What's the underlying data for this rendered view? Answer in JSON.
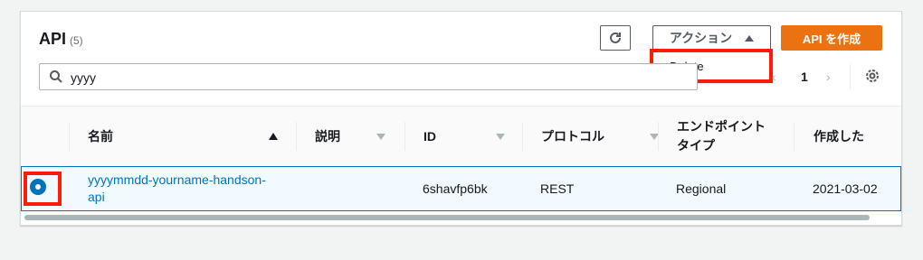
{
  "header": {
    "title": "API",
    "count": "(5)"
  },
  "toolbar": {
    "refresh_icon": "refresh-icon",
    "actions_label": "アクション",
    "create_label": "API を作成"
  },
  "actions_menu": {
    "items": [
      "Delete"
    ]
  },
  "search": {
    "value": "yyyy",
    "icon": "search-icon"
  },
  "pagination": {
    "current_page": "1",
    "prev": "‹",
    "next": "›"
  },
  "settings_icon": "gear-icon",
  "table": {
    "columns": [
      "名前",
      "説明",
      "ID",
      "プロトコル",
      "エンドポイントタイプ",
      "作成した"
    ],
    "endpoint_type_header_line1": "エンドポイント",
    "endpoint_type_header_line2": "タイプ",
    "rows": [
      {
        "selected": true,
        "name_line1": "yyyymmdd-yourname-handson-",
        "name_line2": "api",
        "description": "",
        "id": "6shavfp6bk",
        "protocol": "REST",
        "endpoint_type": "Regional",
        "created": "2021-03-02"
      }
    ]
  },
  "colors": {
    "accent": "#0073bb",
    "primary": "#ec7211",
    "highlight": "#ff1a0a"
  }
}
